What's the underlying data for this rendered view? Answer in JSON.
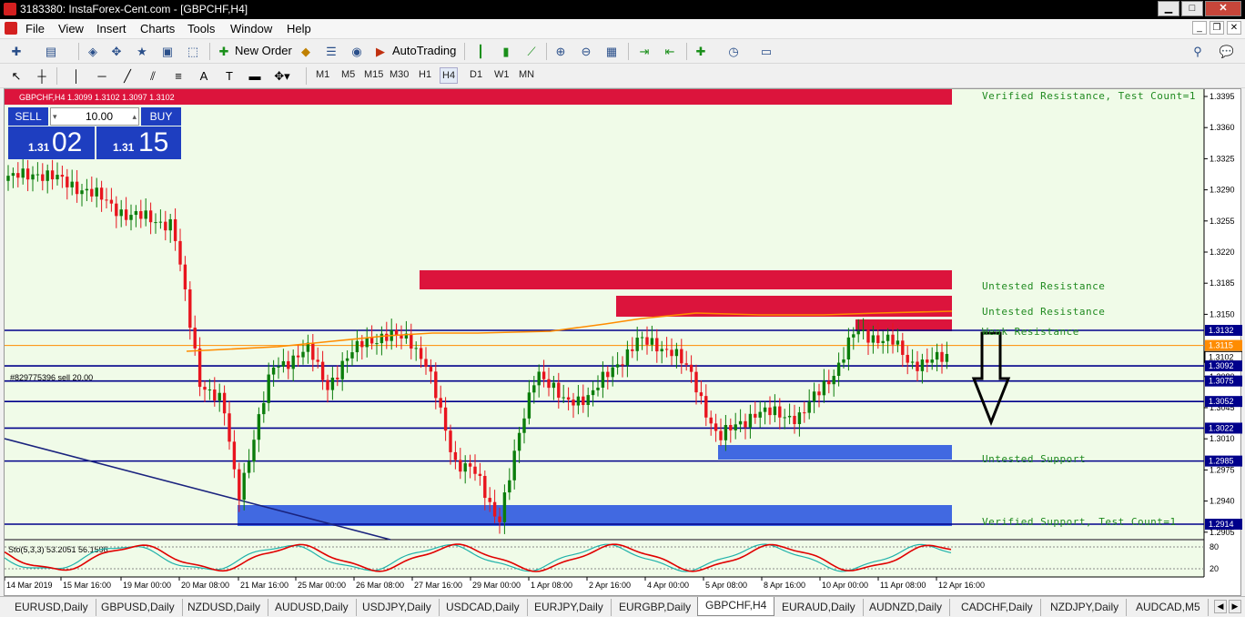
{
  "window": {
    "title": "3183380: InstaForex-Cent.com - [GBPCHF,H4]",
    "min": "▁",
    "max": "□",
    "close": "✕"
  },
  "menu": [
    "File",
    "View",
    "Insert",
    "Charts",
    "Tools",
    "Window",
    "Help"
  ],
  "toolbar": {
    "new_order": "New Order",
    "autotrading": "AutoTrading"
  },
  "timeframes": [
    "M1",
    "M5",
    "M15",
    "M30",
    "H1",
    "H4",
    "D1",
    "W1",
    "MN"
  ],
  "active_timeframe": "H4",
  "chart": {
    "header": "GBPCHF,H4  1.3099 1.3102 1.3097 1.3102",
    "order_label": "#829775396 sell 20.00",
    "indicator_label": "Sto(5,3,3) 53.2051 56.1596",
    "zones_text": {
      "verified_resistance": "Verified Resistance, Test Count=1",
      "untested_resistance_1": "Untested Resistance",
      "untested_resistance_2": "Untested Resistance",
      "weak_resistance": "Weak Resistance",
      "untested_support": "Untested Support",
      "verified_support": "Verified Support, Test Count=1"
    },
    "colors": {
      "bg": "#f0fbe8",
      "bull": "#0b7d0b",
      "bear": "#e8141e",
      "resistance": "#dc143c",
      "support": "#4169e1",
      "hline": "#00008b",
      "ma": "#ff8c00",
      "zone_text": "#1f8a1f"
    }
  },
  "trade_panel": {
    "sell": "SELL",
    "buy": "BUY",
    "lot": "10.00",
    "sell_small": "1.31",
    "sell_big": "02",
    "buy_small": "1.31",
    "buy_big": "15"
  },
  "price_axis": [
    "1.3395",
    "1.3360",
    "1.3325",
    "1.3290",
    "1.3255",
    "1.3220",
    "1.3185",
    "1.3150",
    "1.3080",
    "1.3045",
    "1.3010",
    "1.2975",
    "1.2940",
    "1.2905"
  ],
  "price_tags": [
    "1.3132",
    "1.3115",
    "1.3102",
    "1.3092",
    "1.3075",
    "1.3052",
    "1.3022",
    "1.2985",
    "1.2914"
  ],
  "stoch_axis": [
    "80",
    "20"
  ],
  "time_axis": [
    "14 Mar 2019",
    "15 Mar 16:00",
    "19 Mar 00:00",
    "20 Mar 08:00",
    "21 Mar 16:00",
    "25 Mar 00:00",
    "26 Mar 08:00",
    "27 Mar 16:00",
    "29 Mar 00:00",
    "1 Apr 08:00",
    "2 Apr 16:00",
    "4 Apr 00:00",
    "5 Apr 08:00",
    "8 Apr 16:00",
    "10 Apr 00:00",
    "11 Apr 08:00",
    "12 Apr 16:00"
  ],
  "symbol_tabs": [
    "EURUSD,Daily",
    "GBPUSD,Daily",
    "NZDUSD,Daily",
    "AUDUSD,Daily",
    "USDJPY,Daily",
    "USDCAD,Daily",
    "EURJPY,Daily",
    "EURGBP,Daily",
    "GBPCHF,H4",
    "EURAUD,Daily",
    "AUDNZD,Daily",
    "CADCHF,Daily",
    "NZDJPY,Daily",
    "AUDCAD,M5"
  ],
  "active_tab": "GBPCHF,H4"
}
